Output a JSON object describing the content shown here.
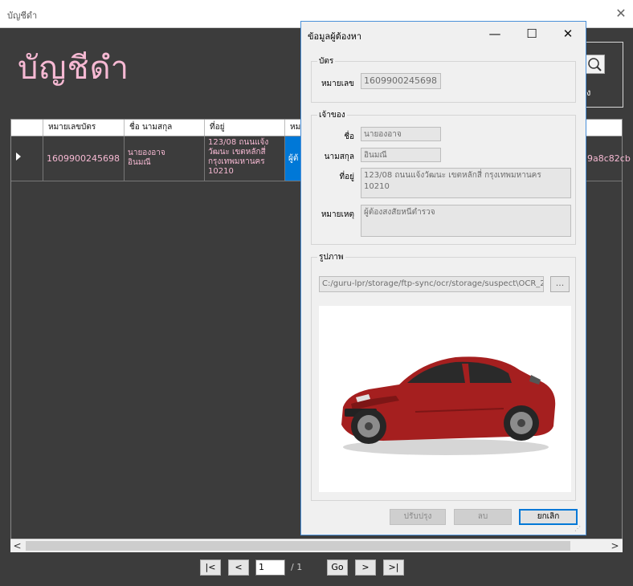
{
  "window": {
    "title": "บัญชีดำ",
    "close_glyph": "✕"
  },
  "page": {
    "heading": "บัญชีดำ"
  },
  "search": {
    "label": "ง"
  },
  "grid": {
    "columns": [
      "หมายเลขบัตร",
      "ชื่อ นามสกุล",
      "ที่อยู่",
      "หม"
    ],
    "rows": [
      {
        "id_number": "1609900245698",
        "name": "นายองอาจ\nอินมณี",
        "address": "123/08 ถนนแจ้ง\nวัฒนะ เขตหลักสี่\nกรุงเทพมหานคร\n10210",
        "note_partial": "ผู้ต้",
        "trailing": "9a8c82cb"
      }
    ]
  },
  "scroll": {
    "left": "<",
    "right": ">"
  },
  "pager": {
    "first": "|<",
    "prev": "<",
    "current_page": "1",
    "total": "/ 1",
    "go": "Go",
    "next": ">",
    "last": ">|"
  },
  "dialog": {
    "title": "ข้อมูลผู้ต้องหา",
    "controls": {
      "minimize": "—",
      "maximize": "☐",
      "close": "✕"
    },
    "card_group": {
      "label": "บัตร",
      "id_label": "หมายเลข",
      "id_value": "1609900245698"
    },
    "owner_group": {
      "label": "เจ้าของ",
      "first_name_label": "ชื่อ",
      "first_name": "นายองอาจ",
      "last_name_label": "นามสกุล",
      "last_name": "อินมณี",
      "address_label": "ที่อยู่",
      "address": "123/08 ถนนแจ้งวัฒนะ เขตหลักสี่ กรุงเทพมหานคร 10210",
      "note_label": "หมายเหตุ",
      "note": "ผู้ต้องสงสัยหนีตำรวจ"
    },
    "image_group": {
      "label": "รูปภาพ",
      "path": "C:/guru-lpr/storage/ftp-sync/ocr/storage/suspect\\OCR_2",
      "browse": "..."
    },
    "buttons": {
      "update": "ปรับปรุง",
      "delete": "ลบ",
      "cancel": "ยกเลิก"
    }
  }
}
